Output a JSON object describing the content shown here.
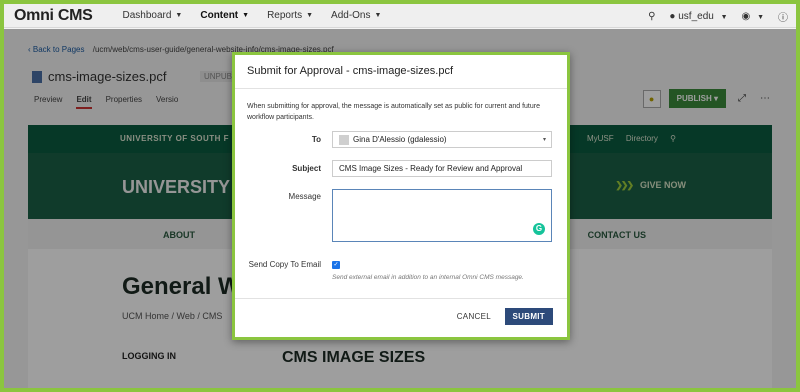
{
  "app": {
    "logo": "Omni CMS",
    "nav": [
      {
        "label": "Dashboard"
      },
      {
        "label": "Content"
      },
      {
        "label": "Reports"
      },
      {
        "label": "Add-Ons"
      }
    ],
    "site_selector": "usf_edu"
  },
  "page": {
    "back_link": "Back to Pages",
    "path": "/ucm/web/cms-user-guide/general-website-info/cms-image-sizes.pcf",
    "file_name": "cms-image-sizes.pcf",
    "status": "UNPUBLI",
    "tabs": [
      "Preview",
      "Edit",
      "Properties",
      "Versio"
    ],
    "publish_label": "PUBLISH"
  },
  "site": {
    "university_bar": "UNIVERSITY OF SOUTH F",
    "top_links": [
      "MyUSF",
      "Directory"
    ],
    "hero_title": "UNIVERSITY O",
    "give_now": "GIVE NOW",
    "about": "ABOUT",
    "contact": "CONTACT US",
    "heading": "General Web",
    "breadcrumb": "UCM Home / Web / CMS",
    "logging_in": "LOGGING IN",
    "section_title": "CMS IMAGE SIZES"
  },
  "modal": {
    "title": "Submit for Approval - cms-image-sizes.pcf",
    "info": "When submitting for approval, the message is automatically set as public for current and future workflow participants.",
    "to_label": "To",
    "to_value": "Gina D'Alessio (gdalessio)",
    "subject_label": "Subject",
    "subject_value": "CMS Image Sizes - Ready for Review and Approval",
    "message_label": "Message",
    "message_value": "",
    "send_copy_label": "Send Copy To Email",
    "send_copy_checked": true,
    "send_copy_help": "Send external email in addition to an internal Omni CMS message.",
    "cancel_label": "CANCEL",
    "submit_label": "SUBMIT"
  }
}
